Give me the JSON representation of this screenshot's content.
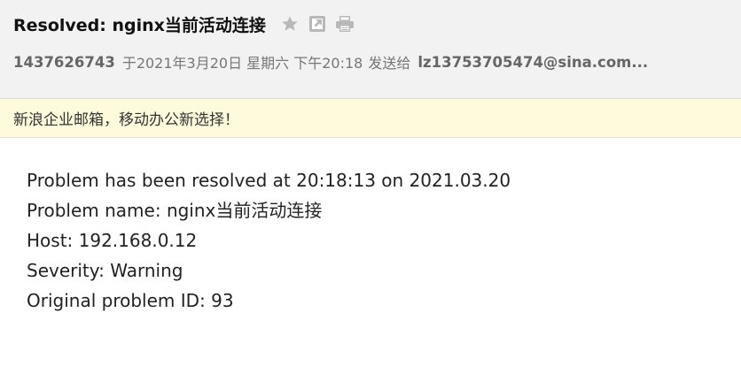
{
  "email": {
    "subject": "Resolved: nginx当前活动连接",
    "sender": "1437626743",
    "date_text": "于2021年3月20日 星期六 下午20:18",
    "send_to_label": "发送给",
    "recipient": "lz13753705474@sina.com...",
    "actions": [
      {
        "name": "star-icon"
      },
      {
        "name": "open-external-icon"
      },
      {
        "name": "print-icon"
      }
    ]
  },
  "banner": {
    "text": "新浪企业邮箱，移动办公新选择！"
  },
  "body": {
    "lines": [
      "Problem has been resolved at 20:18:13 on 2021.03.20",
      "Problem name: nginx当前活动连接",
      "Host: 192.168.0.12",
      "Severity: Warning",
      "Original problem ID: 93"
    ]
  },
  "colors": {
    "header_bg": "#f2f2f2",
    "banner_bg": "#fdfbdc",
    "icon_gray": "#b8b8b8"
  }
}
